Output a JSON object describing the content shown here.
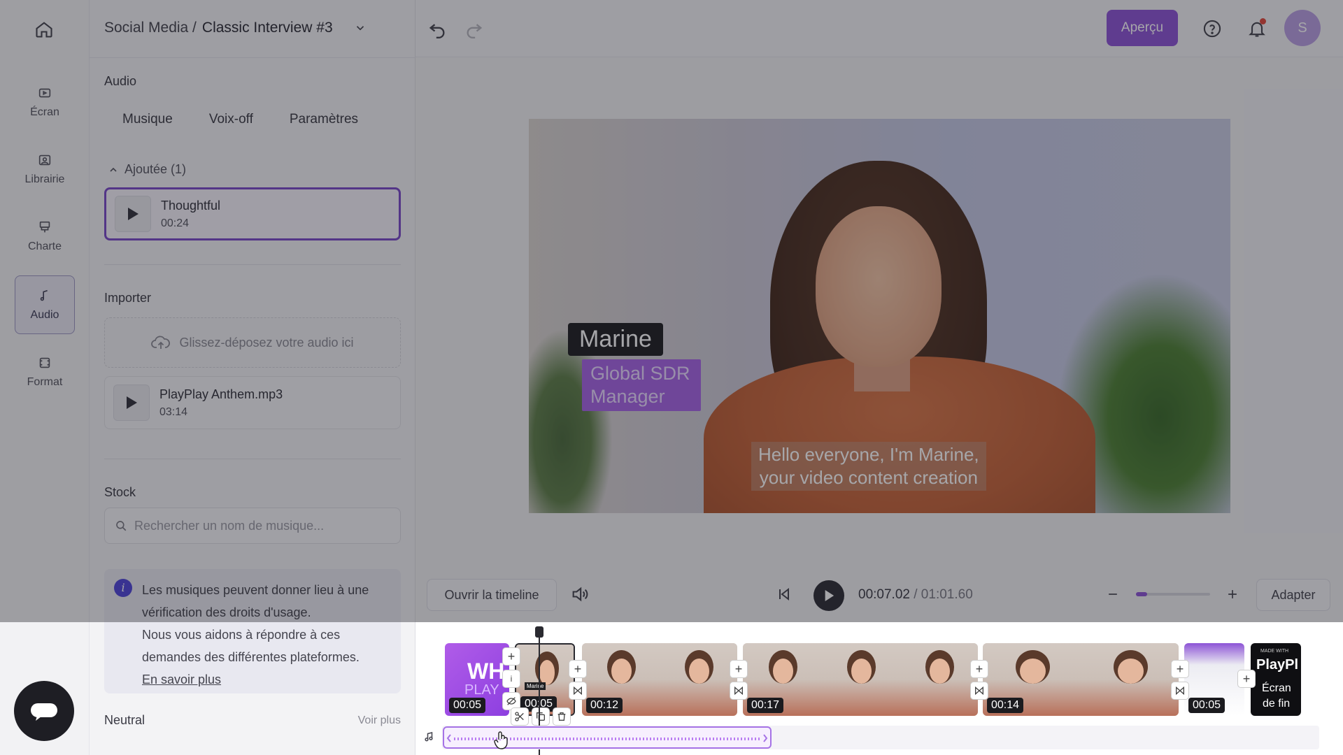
{
  "header": {
    "breadcrumb_parent": "Social Media /",
    "breadcrumb_current": "Classic Interview #3",
    "preview_label": "Aperçu",
    "avatar_initial": "S"
  },
  "rail": {
    "items": [
      {
        "label": "Écran",
        "icon": "screen-icon"
      },
      {
        "label": "Librairie",
        "icon": "library-icon"
      },
      {
        "label": "Charte",
        "icon": "brand-icon"
      },
      {
        "label": "Audio",
        "icon": "music-note-icon",
        "active": true
      },
      {
        "label": "Format",
        "icon": "format-icon"
      }
    ]
  },
  "panel": {
    "section_title": "Audio",
    "tabs": [
      "Musique",
      "Voix-off",
      "Paramètres"
    ],
    "added_label": "Ajoutée (1)",
    "added_track": {
      "name": "Thoughtful",
      "duration": "00:24"
    },
    "import_title": "Importer",
    "dropzone_text": "Glissez-déposez votre audio ici",
    "imported_track": {
      "name": "PlayPlay Anthem.mp3",
      "duration": "03:14"
    },
    "stock_title": "Stock",
    "search_placeholder": "Rechercher un nom de musique...",
    "info_lines": [
      "Les musiques peuvent donner lieu à une",
      "vérification des droits d'usage.",
      "Nous vous aidons à répondre à ces",
      "demandes des différentes plateformes."
    ],
    "info_link": "En savoir plus",
    "category_title": "Neutral",
    "see_more": "Voir plus"
  },
  "video": {
    "name_tag": "Marine",
    "role_line1": "Global SDR",
    "role_line2": "Manager",
    "subtitle_line1": "Hello everyone, I'm Marine,",
    "subtitle_line2": "your video content creation"
  },
  "controls": {
    "open_timeline": "Ouvrir la timeline",
    "time_current": "00:07.02",
    "time_total": "/ 01:01.60",
    "fit_label": "Adapter",
    "zoom_level": 0.15
  },
  "timeline": {
    "clips": [
      {
        "duration": "00:05",
        "title_text": "WH",
        "sub_text": "PLAY"
      },
      {
        "duration": "00:05"
      },
      {
        "duration": "00:12"
      },
      {
        "duration": "00:17"
      },
      {
        "duration": "00:14"
      },
      {
        "duration": "00:05"
      },
      {
        "end_brand": "PlayPl",
        "end_label_1": "Écran",
        "end_label_2": "de fin",
        "end_badge": "MADE WITH"
      }
    ],
    "small_tag": "Marine"
  },
  "colors": {
    "accent": "#8d54d6",
    "selected_border": "#7a49c9",
    "role_tag": "#a664e6"
  }
}
